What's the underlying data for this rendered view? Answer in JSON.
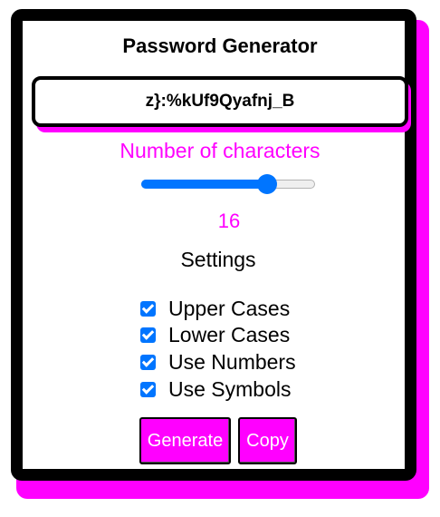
{
  "app": {
    "title": "Password Generator",
    "password": "z}:%kUf9Qyafnj_B"
  },
  "length": {
    "label": "Number of characters",
    "value": 16,
    "value_text": "16",
    "min": 4,
    "max": 20
  },
  "settings": {
    "heading": "Settings",
    "options": [
      {
        "label": "Upper Cases",
        "checked": true
      },
      {
        "label": "Lower Cases",
        "checked": true
      },
      {
        "label": "Use Numbers",
        "checked": true
      },
      {
        "label": "Use Symbols",
        "checked": true
      }
    ]
  },
  "buttons": {
    "generate_label": "Generate",
    "copy_label": "Copy"
  },
  "colors": {
    "accent": "#ff00ff",
    "slider": "#0075ff",
    "border": "#000000"
  }
}
